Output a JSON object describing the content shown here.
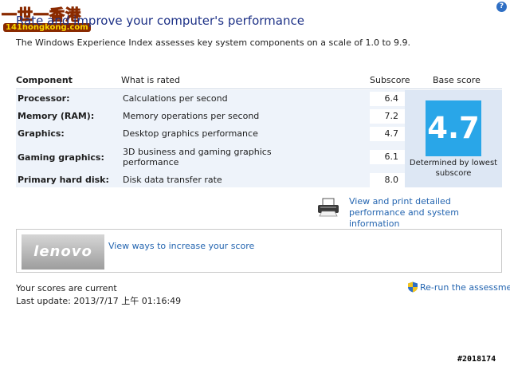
{
  "watermark": {
    "line1": "一世一香港",
    "line2": "141hongkong.com"
  },
  "page": {
    "title": "Rate and improve your computer's performance",
    "intro": "The Windows Experience Index assesses key system components on a scale of 1.0 to 9.9."
  },
  "table": {
    "headers": {
      "component": "Component",
      "rated": "What is rated",
      "subscore": "Subscore",
      "base": "Base score"
    },
    "rows": [
      {
        "component": "Processor:",
        "rated": "Calculations per second",
        "subscore": "6.4"
      },
      {
        "component": "Memory (RAM):",
        "rated": "Memory operations per second",
        "subscore": "7.2"
      },
      {
        "component": "Graphics:",
        "rated": "Desktop graphics performance",
        "subscore": "4.7"
      },
      {
        "component": "Gaming graphics:",
        "rated": "3D business and gaming graphics performance",
        "subscore": "6.1"
      },
      {
        "component": "Primary hard disk:",
        "rated": "Disk data transfer rate",
        "subscore": "8.0"
      }
    ],
    "base_score": "4.7",
    "base_caption": "Determined by lowest subscore"
  },
  "links": {
    "print": "View and print detailed performance and system information",
    "ways": "View ways to increase your score",
    "rerun": "Re-run the assessment"
  },
  "ad": {
    "logo_text": "lenovo"
  },
  "status": {
    "current": "Your scores are current",
    "last_update": "Last update: 2013/7/17 上午 01:16:49"
  },
  "post_id": "#2018174",
  "icons": {
    "help": "help-icon",
    "printer": "printer-icon",
    "shield": "uac-shield-icon"
  },
  "colors": {
    "title": "#1e3287",
    "link": "#2465b0",
    "score_box": "#29a6e8",
    "row_bg": "#eef3fa"
  }
}
